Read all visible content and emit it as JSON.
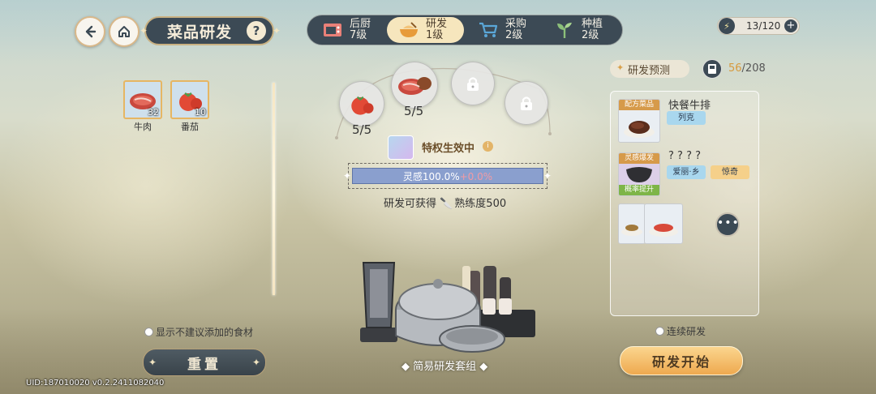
{
  "header": {
    "title": "菜品研发",
    "help_label": "?",
    "energy": "13/120",
    "energy_plus": "+"
  },
  "tabs": [
    {
      "name": "后厨",
      "level": "7级",
      "icon": "oven-icon",
      "active": false
    },
    {
      "name": "研发",
      "level": "1级",
      "icon": "cooking-bowl-icon",
      "active": true
    },
    {
      "name": "采购",
      "level": "2级",
      "icon": "shopping-cart-icon",
      "active": false
    },
    {
      "name": "种植",
      "level": "2级",
      "icon": "sprout-icon",
      "active": false
    }
  ],
  "ingredients": [
    {
      "label": "牛肉",
      "count": "32",
      "icon": "beef-icon"
    },
    {
      "label": "番茄",
      "count": "10",
      "icon": "tomato-icon"
    }
  ],
  "slots": {
    "tomato_count": "5/5",
    "beef_count": "5/5"
  },
  "privilege": {
    "text": "特权生效中",
    "info": "i"
  },
  "inspiration": {
    "base": "灵感100.0%",
    "bonus": "+0.0%"
  },
  "gain": {
    "prefix": "研发可获得",
    "text": "熟练度500"
  },
  "cooking_set": {
    "label": "简易研发套组"
  },
  "prediction": {
    "title": "研发预测",
    "collected": "56",
    "total": "/208",
    "recipes": [
      {
        "tag": "配方菜品",
        "name": "快餐牛排",
        "chips": [
          "列克"
        ]
      },
      {
        "tag": "灵感爆发",
        "sub_tag": "概率提升",
        "name": "? ? ? ?",
        "chips": [
          "爱丽·乡",
          "惊奇"
        ]
      }
    ],
    "more": "•••"
  },
  "options": {
    "show_not_recommended": "显示不建议添加的食材",
    "continuous": "连续研发"
  },
  "buttons": {
    "reset": "重置",
    "start": "研发开始"
  },
  "uid": "UID:187010020  v0.2.2411082040",
  "colors": {
    "panel_dark": "#3c4a55",
    "accent_gold": "#e6b663",
    "start_button": "#eea94f",
    "inspiration_bar": "#8a9fce"
  }
}
